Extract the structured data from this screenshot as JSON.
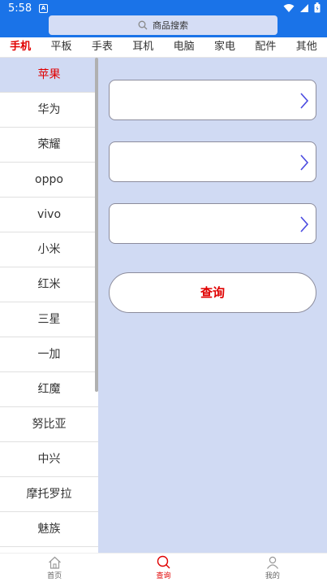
{
  "status": {
    "time": "5:58",
    "notif": "A"
  },
  "search": {
    "placeholder": "商品搜索"
  },
  "tabs": [
    {
      "label": "手机",
      "active": true
    },
    {
      "label": "平板"
    },
    {
      "label": "手表"
    },
    {
      "label": "耳机"
    },
    {
      "label": "电脑"
    },
    {
      "label": "家电"
    },
    {
      "label": "配件"
    },
    {
      "label": "其他"
    }
  ],
  "brands": [
    "苹果",
    "华为",
    "荣耀",
    "oppo",
    "vivo",
    "小米",
    "红米",
    "三星",
    "一加",
    "红魔",
    "努比亚",
    "中兴",
    "摩托罗拉",
    "魅族"
  ],
  "form": {
    "query_label": "查询"
  },
  "nav": [
    {
      "label": "首页",
      "icon": "home-icon"
    },
    {
      "label": "查询",
      "icon": "search-icon",
      "active": true
    },
    {
      "label": "我的",
      "icon": "user-icon"
    }
  ],
  "colors": {
    "primary": "#1a73e8",
    "accent": "#e00000",
    "panel": "#d0daf3"
  }
}
